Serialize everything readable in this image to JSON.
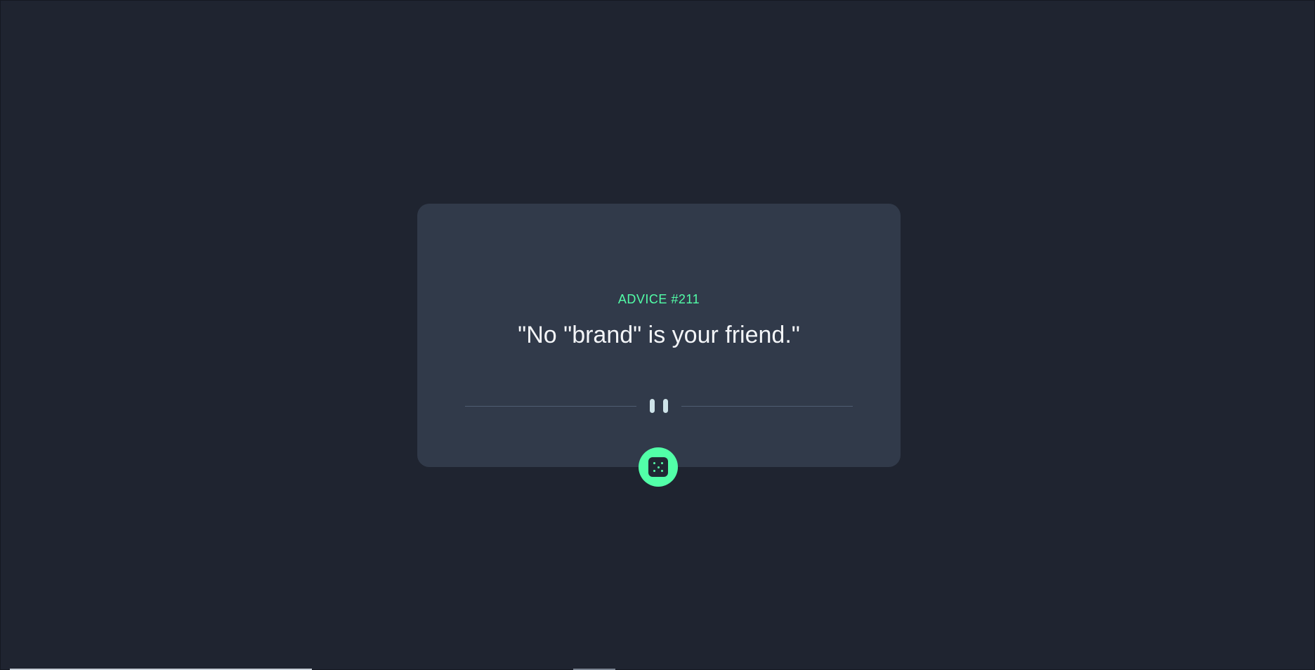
{
  "advice": {
    "label": "ADVICE #211",
    "quote": "\"No \"brand\" is your friend.\""
  },
  "icons": {
    "divider": "pause-icon",
    "generate": "dice-icon"
  },
  "colors": {
    "background": "#1f2430",
    "card": "#313a4a",
    "accent": "#52ffa8",
    "text": "#f3f5f8"
  }
}
